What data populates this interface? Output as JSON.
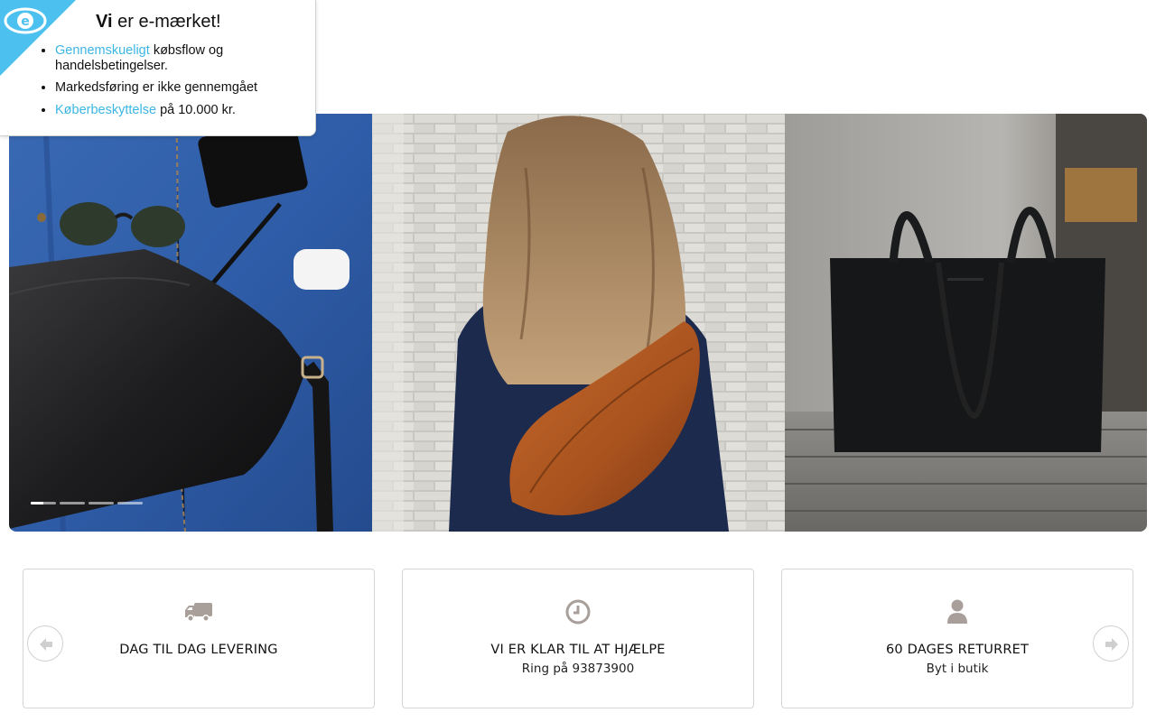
{
  "emark": {
    "title_bold": "Vi",
    "title_rest": "er e-mærket!",
    "items": [
      {
        "link": "Gennemskueligt",
        "text": "købsflow og handelsbetingelser."
      },
      {
        "link": "",
        "text": "Markedsføring er ikke gennemgået"
      },
      {
        "link": "Køberbeskyttelse",
        "text": "på 10.000 kr."
      }
    ],
    "link_color": "#3cb6e3",
    "badge_color": "#4cc0ee",
    "logo_icon": "e-maerket-logo-icon"
  },
  "slider": {
    "slides": 4,
    "active_index": 0,
    "panels": [
      {
        "icon": "product-photo-leather-pouch-flatlay"
      },
      {
        "icon": "product-photo-cognac-bumbag-woman"
      },
      {
        "icon": "product-photo-black-tote-bag"
      }
    ]
  },
  "usp": {
    "cards": [
      {
        "icon": "truck-icon",
        "title": "DAG TIL DAG LEVERING",
        "subtitle": ""
      },
      {
        "icon": "clock-icon",
        "title": "VI ER KLAR TIL AT HJÆLPE",
        "subtitle": "Ring på 93873900"
      },
      {
        "icon": "user-icon",
        "title": "60 DAGES RETURRET",
        "subtitle": "Byt i butik"
      }
    ],
    "icon_color": "#a89f9a"
  }
}
